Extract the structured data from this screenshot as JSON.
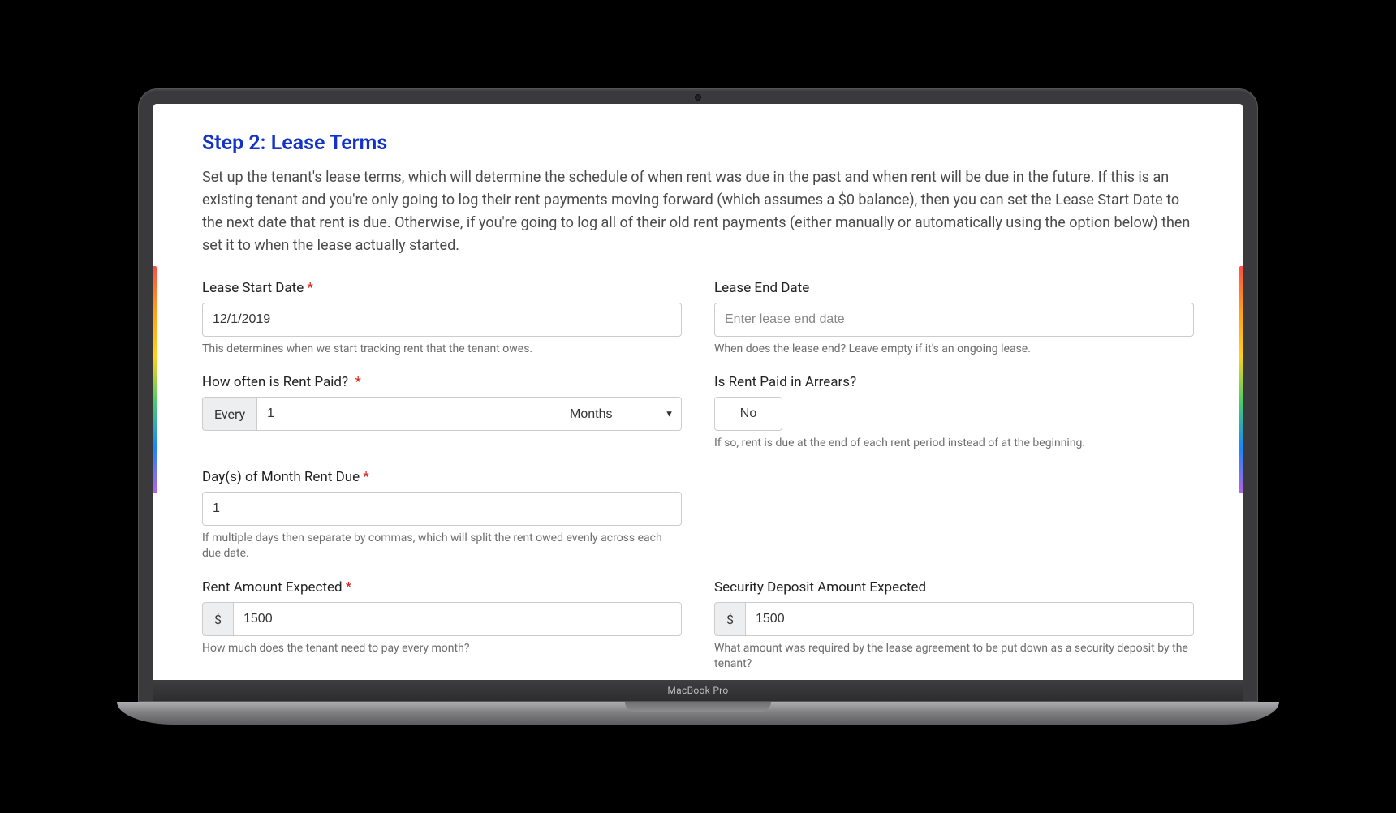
{
  "step": {
    "title": "Step 2: Lease Terms",
    "description": "Set up the tenant's lease terms, which will determine the schedule of when rent was due in the past and when rent will be due in the future. If this is an existing tenant and you're only going to log their rent payments moving forward (which assumes a $0 balance), then you can set the Lease Start Date to the next date that rent is due. Otherwise, if you're going to log all of their old rent payments (either manually or automatically using the option below) then set it to when the lease actually started."
  },
  "leaseStart": {
    "label": "Lease Start Date",
    "required": "*",
    "value": "12/1/2019",
    "help": "This determines when we start tracking rent that the tenant owes."
  },
  "leaseEnd": {
    "label": "Lease End Date",
    "placeholder": "Enter lease end date",
    "help": "When does the lease end? Leave empty if it's an ongoing lease."
  },
  "frequency": {
    "label": "How often is Rent Paid?",
    "required": "*",
    "prefix": "Every",
    "count": "1",
    "unit": "Months"
  },
  "arrears": {
    "label": "Is Rent Paid in Arrears?",
    "value": "No",
    "help": "If so, rent is due at the end of each rent period instead of at the beginning."
  },
  "dueDays": {
    "label": "Day(s) of Month Rent Due",
    "required": "*",
    "value": "1",
    "help": "If multiple days then separate by commas, which will split the rent owed evenly across each due date."
  },
  "rent": {
    "label": "Rent Amount Expected",
    "required": "*",
    "currency": "$",
    "value": "1500",
    "help": "How much does the tenant need to pay every month?"
  },
  "deposit": {
    "label": "Security Deposit Amount Expected",
    "currency": "$",
    "value": "1500",
    "help": "What amount was required by the lease agreement to be put down as a security deposit by the tenant?"
  },
  "device": {
    "name": "MacBook Pro"
  }
}
